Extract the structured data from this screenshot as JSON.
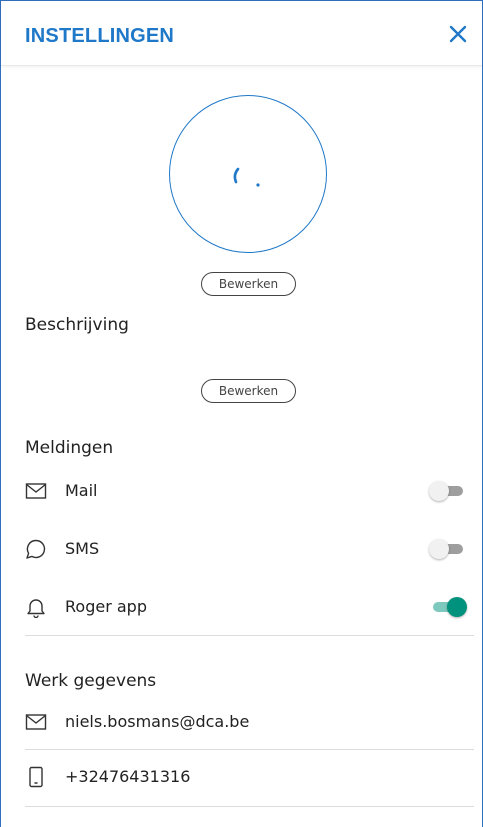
{
  "header": {
    "title": "INSTELLINGEN"
  },
  "profile": {
    "edit_label": "Bewerken"
  },
  "description": {
    "title": "Beschrijving",
    "edit_label": "Bewerken"
  },
  "notifications": {
    "title": "Meldingen",
    "items": [
      {
        "label": "Mail",
        "icon": "mail-icon",
        "enabled": false
      },
      {
        "label": "SMS",
        "icon": "chat-bubble-icon",
        "enabled": false
      },
      {
        "label": "Roger app",
        "icon": "bell-icon",
        "enabled": true
      }
    ]
  },
  "work": {
    "title": "Werk gegevens",
    "email": "niels.bosmans@dca.be",
    "phone": "+32476431316"
  },
  "colors": {
    "accent": "#1f78c8",
    "toggle_on": "#00927c",
    "toggle_on_track": "#7ec9bd"
  }
}
